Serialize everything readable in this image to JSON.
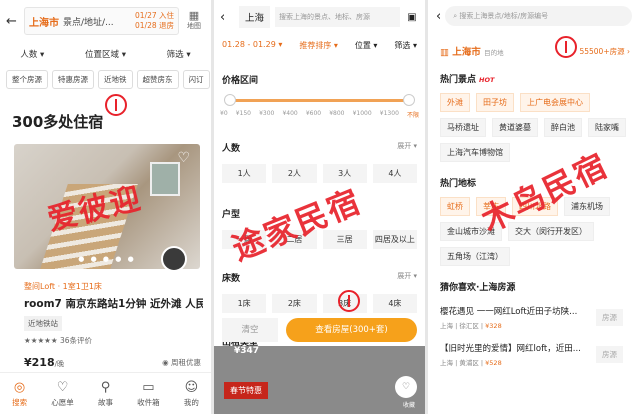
{
  "panel1": {
    "city": "上海市",
    "search_placeholder": "景点/地址/...",
    "checkin": "01/27 入住",
    "checkout": "01/28 退房",
    "map_label": "地图",
    "filters": [
      "人数 ▾",
      "位置区域 ▾",
      "筛选 ▾"
    ],
    "tags": [
      "整个房源",
      "特惠房源",
      "近地铁",
      "超赞房东",
      "闪订"
    ],
    "count": "300多处住宿",
    "listing": {
      "subtitle": "整间Loft · 1室1卫1床",
      "title": "room7 南京东路站1分钟 近外滩 人民...",
      "badge": "近地铁站",
      "review": "★★★★★ 36条评价",
      "price": "¥218",
      "price_unit": "/晚",
      "perk": "◉ 周租优惠"
    },
    "nav": [
      {
        "icon": "◎",
        "label": "搜索"
      },
      {
        "icon": "♡",
        "label": "心愿单"
      },
      {
        "icon": "⚲",
        "label": "故事"
      },
      {
        "icon": "▭",
        "label": "收件箱"
      },
      {
        "icon": "☺",
        "label": "我的"
      }
    ],
    "annotation": "爱彼迎"
  },
  "panel2": {
    "city": "上海",
    "search_placeholder": "搜索上海的景点、地标、房源",
    "dates": "01.28 - 01.29 ▾",
    "sort": "推荐排序 ▾",
    "location": "位置 ▾",
    "filter": "筛选 ▾",
    "price_title": "价格区间",
    "price_ticks": [
      "¥0",
      "¥150",
      "¥300",
      "¥400",
      "¥600",
      "¥800",
      "¥1000",
      "¥1300",
      "不限"
    ],
    "people_title": "人数",
    "expand": "展开 ▾",
    "people": [
      "1人",
      "2人",
      "3人",
      "4人"
    ],
    "layout_title": "户型",
    "layouts": [
      "一居",
      "二居",
      "三居",
      "四居及以上"
    ],
    "beds_title": "床数",
    "beds": [
      "1床",
      "2床",
      "3床",
      "4床"
    ],
    "rent_title": "出租类型",
    "reset": "清空",
    "submit": "查看房屋(300+套)",
    "price_peek": "¥347",
    "festival": "春节特惠",
    "fav": "收藏",
    "annotation": "途家民宿"
  },
  "panel3": {
    "search_placeholder": "搜索上海景点/地标/房源编号",
    "dest_city": "上海市",
    "dest_sub": "目的地",
    "dest_count": "55500+房源 ›",
    "hot_title": "热门景点",
    "hot_tag": "HOT",
    "hot_chips": [
      "外滩",
      "田子坊",
      "上广电会展中心"
    ],
    "plain_chips": [
      "马桥遗址",
      "黄道婆墓",
      "醉白池",
      "陆家嘴",
      "上海汽车博物馆"
    ],
    "land_title": "热门地标",
    "land_chips": [
      "虹桥",
      "莘庄",
      "四川北路"
    ],
    "land_plain": [
      "浦东机场",
      "金山城市沙滩",
      "交大（闵行开发区）",
      "五角场（江湾）"
    ],
    "rec_title": "猜你喜欢·上海房源",
    "rooms": [
      {
        "title": "樱花遇见 一一网红Loft近田子坊陕...",
        "meta": "上海 | 徐汇区",
        "price": "¥328",
        "type": "房源"
      },
      {
        "title": "【旧时光里的爱情】网红loft，近田...",
        "meta": "上海 | 黄浦区",
        "price": "¥528",
        "type": "房源"
      }
    ],
    "annotation": "木鸟民宿"
  }
}
